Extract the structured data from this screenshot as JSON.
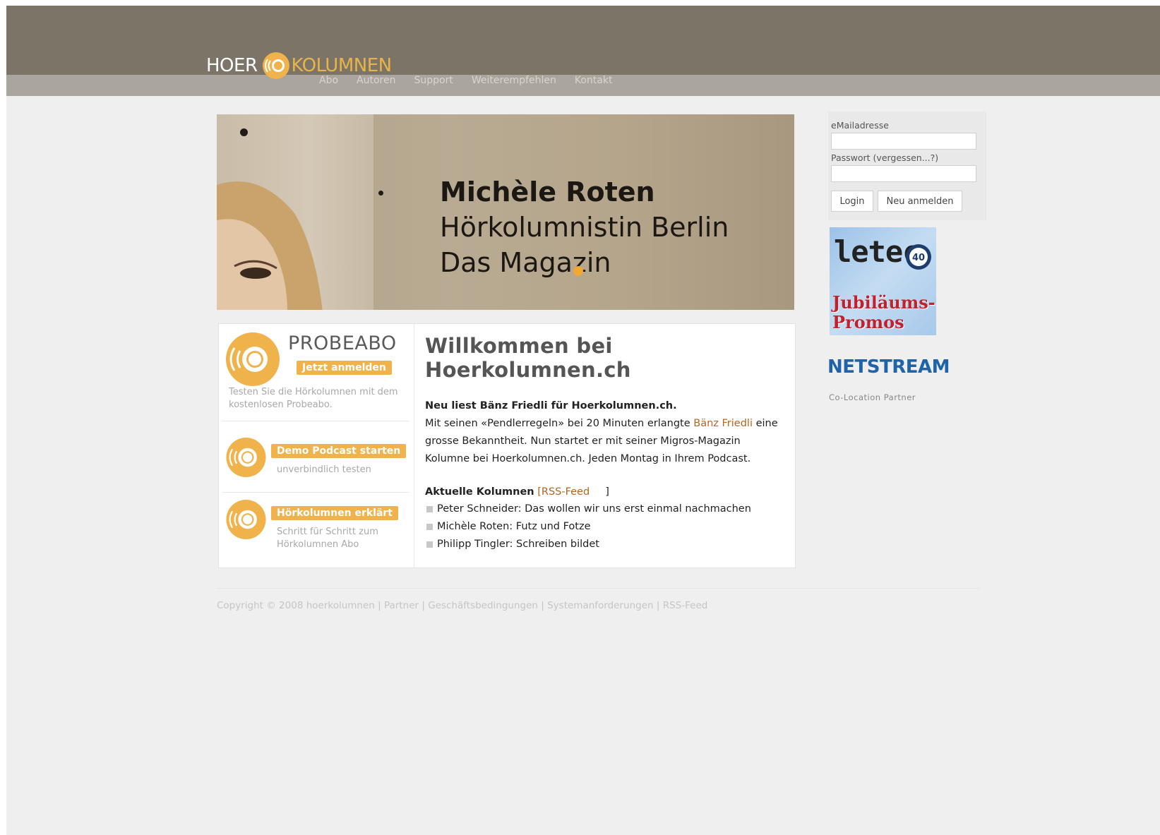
{
  "header": {
    "logo_part1": "HOER",
    "logo_part2": "KOLUMNEN",
    "nav": [
      "Abo",
      "Autoren",
      "Support",
      "Weiterempfehlen",
      "Kontakt"
    ]
  },
  "hero": {
    "line1": "Michèle Roten",
    "line2": "Hörkolumnistin Berlin",
    "line3": "Das Magazin"
  },
  "promos": {
    "probeabo_title": "PROBEABO",
    "probeabo_button": "Jetzt anmelden",
    "probeabo_text": "Testen Sie die Hörkolumnen mit dem kostenlosen Probeabo.",
    "demo_button": "Demo Podcast starten",
    "demo_text": "unverbindlich testen",
    "explained_button": "Hörkolumnen erklärt",
    "explained_text": "Schritt für Schritt zum Hörkolumnen Abo"
  },
  "main": {
    "welcome": "Willkommen bei Hoerkolumnen.ch",
    "news_headline": "Neu liest Bänz Friedli für Hoerkolumnen.ch.",
    "news_text_1": "Mit seinen «Pendlerregeln» bei 20 Minuten erlangte ",
    "news_link": "Bänz Friedli",
    "news_text_2": " eine grosse Bekanntheit. Nun startet er mit seiner Migros-Magazin Kolumne bei Hoerkolumnen.ch. Jeden Montag in Ihrem Podcast.",
    "current_title": "Aktuelle Kolumnen",
    "rss_open": " [RSS-Feed",
    "rss_close": "]",
    "columns": [
      "Peter Schneider: Das wollen wir uns erst einmal nachmachen",
      "Michèle Roten: Futz und Fotze",
      "Philipp Tingler: Schreiben bildet"
    ]
  },
  "login": {
    "email_label": "eMailadresse",
    "password_label": "Passwort (vergessen...?)",
    "login_button": "Login",
    "register_button": "Neu anmelden"
  },
  "sponsors": {
    "ad_brand": "letec",
    "ad_badge": "40",
    "ad_line1": "Jubiläums-",
    "ad_line2": "Promos",
    "netstream": "NETSTREAM",
    "netstream_caption": "Co-Location Partner"
  },
  "footer": {
    "copyright": "Copyright © 2008 hoerkolumnen",
    "links": [
      "Partner",
      "Geschäftsbedingungen",
      "Systemanforderungen",
      "RSS-Feed"
    ],
    "separator": " | "
  },
  "colors": {
    "top_bar": "#7d7468",
    "nav_bar": "#aaa59e",
    "accent": "#f0b24a",
    "link": "#b5651d"
  }
}
